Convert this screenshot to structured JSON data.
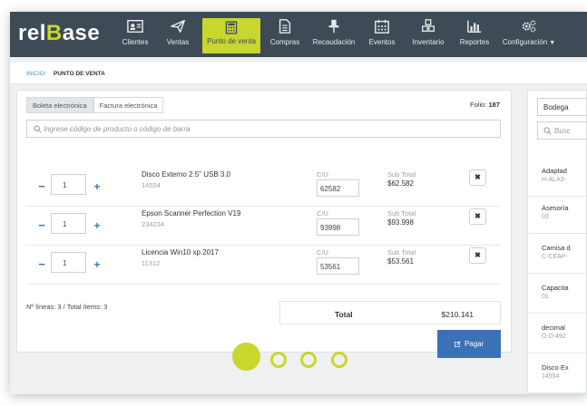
{
  "brand": {
    "logo_pre": "rel",
    "logo_b": "B",
    "logo_post": "ase"
  },
  "nav": {
    "items": [
      {
        "label": "Clientes",
        "icon": "id-card-icon"
      },
      {
        "label": "Ventas",
        "icon": "paper-plane-icon"
      },
      {
        "label": "Punto de venta",
        "icon": "calculator-icon"
      },
      {
        "label": "Compras",
        "icon": "document-icon"
      },
      {
        "label": "Recaudación",
        "icon": "pin-icon"
      },
      {
        "label": "Eventos",
        "icon": "calendar-icon"
      },
      {
        "label": "Inventario",
        "icon": "cubes-icon"
      },
      {
        "label": "Reportes",
        "icon": "bar-chart-icon"
      },
      {
        "label": "Configuración",
        "icon": "gears-icon"
      }
    ],
    "active": "Punto de venta"
  },
  "breadcrumb": {
    "home": "INICIO",
    "sep": "/",
    "current": "PUNTO DE VENTA"
  },
  "tabs": [
    "Boleta electrónica",
    "Factura electrónica"
  ],
  "folio": {
    "label": "Folio:",
    "value": "187"
  },
  "search": {
    "placeholder": "Ingrese código de producto o código de barra"
  },
  "lines_header": {
    "cu": "C/U",
    "subtotal": "Sub Total"
  },
  "lines": [
    {
      "qty": "1",
      "name": "Disco Externo 2.5\" USB 3.0",
      "code": "14554",
      "cu": "62582",
      "subtotal": "$62.582"
    },
    {
      "qty": "1",
      "name": "Epson Scanner Perfection V19",
      "code": "234234",
      "cu": "93998",
      "subtotal": "$93.998"
    },
    {
      "qty": "1",
      "name": "Licencia Win10 xp 2017",
      "code": "11312",
      "cu": "53561",
      "subtotal": "$53.561"
    }
  ],
  "summary": {
    "counts": "Nº líneas: 3 / Total ítems: 3",
    "total_label": "Total",
    "total_value": "$210.141"
  },
  "pay_button": "Pagar",
  "right_panel": {
    "select": "Bodega",
    "search_placeholder": "Busc",
    "items": [
      {
        "name": "Adaptad",
        "code": "H-ALA3-"
      },
      {
        "name": "Asesoría",
        "code": "03"
      },
      {
        "name": "Camisa d",
        "code": "C-CEAP-"
      },
      {
        "name": "Capacita",
        "code": "01"
      },
      {
        "name": "decimal",
        "code": "O-D-492"
      },
      {
        "name": "Disco Ex",
        "code": "14554"
      }
    ]
  },
  "colors": {
    "topbar": "#3e4a56",
    "accent": "#c8d62e",
    "primary": "#3a72b8"
  }
}
